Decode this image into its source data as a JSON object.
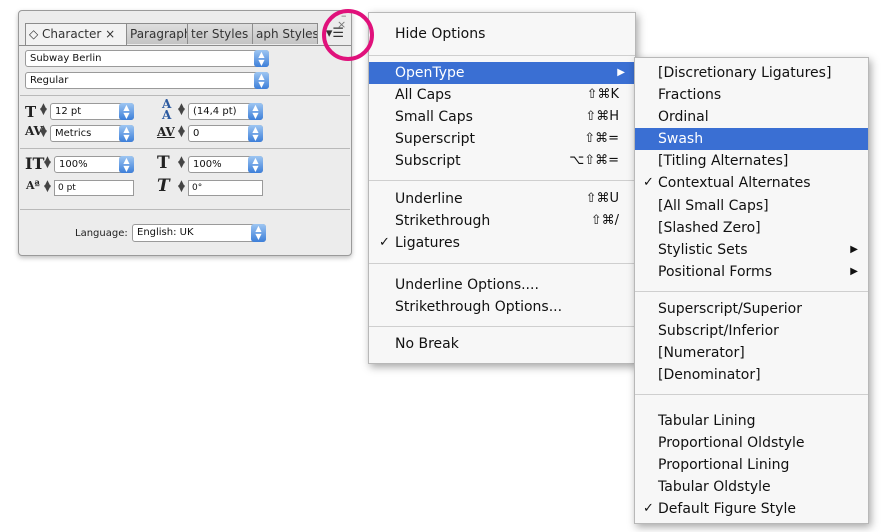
{
  "character_panel": {
    "tabs": [
      "◇ Character ×",
      "Paragraph",
      "ter Styles",
      "aph Styles"
    ],
    "font_family": "Subway Berlin",
    "font_style": "Regular",
    "font_size": "12 pt",
    "leading": "(14,4 pt)",
    "kerning": "Metrics",
    "tracking": "0",
    "vertical_scale": "100%",
    "horizontal_scale": "100%",
    "baseline_shift": "0 pt",
    "skew": "0°",
    "language_label": "Language:",
    "language": "English: UK",
    "panel_menu_icon": "▾☰",
    "close_icon": "×",
    "minimize_icon": "–"
  },
  "main_menu": {
    "hide_options": "Hide Options",
    "opentype": "OpenType",
    "all_caps": "All Caps",
    "all_caps_sc": "⇧⌘K",
    "small_caps": "Small Caps",
    "small_caps_sc": "⇧⌘H",
    "superscript": "Superscript",
    "superscript_sc": "⇧⌘=",
    "subscript": "Subscript",
    "subscript_sc": "⌥⇧⌘=",
    "underline": "Underline",
    "underline_sc": "⇧⌘U",
    "strikethrough": "Strikethrough",
    "strikethrough_sc": "⇧⌘/",
    "ligatures": "Ligatures",
    "underline_options": "Underline Options....",
    "strikethrough_options": "Strikethrough Options...",
    "no_break": "No Break",
    "check": "✓",
    "submenu_arrow": "▶"
  },
  "opentype_menu": {
    "discretionary_ligatures": "[Discretionary Ligatures]",
    "fractions": "Fractions",
    "ordinal": "Ordinal",
    "swash": "Swash",
    "titling_alternates": "[Titling Alternates]",
    "contextual_alternates": "Contextual Alternates",
    "all_small_caps": "[All Small Caps]",
    "slashed_zero": "[Slashed Zero]",
    "stylistic_sets": "Stylistic Sets",
    "positional_forms": "Positional Forms",
    "superscript_superior": "Superscript/Superior",
    "subscript_inferior": "Subscript/Inferior",
    "numerator": "[Numerator]",
    "denominator": "[Denominator]",
    "tabular_lining": "Tabular Lining",
    "proportional_oldstyle": "Proportional Oldstyle",
    "proportional_lining": "Proportional Lining",
    "tabular_oldstyle": "Tabular Oldstyle",
    "default_figure_style": "Default Figure Style"
  },
  "colors": {
    "highlight": "#3a6fd3",
    "ring": "#e0117b",
    "select_arrows": "#3d7fd9"
  }
}
